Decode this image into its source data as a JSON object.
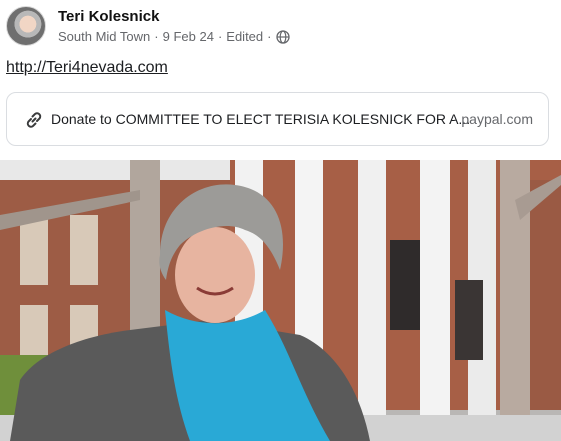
{
  "post": {
    "author_name": "Teri Kolesnick",
    "location": "South Mid Town",
    "date": "9 Feb 24",
    "edited": "Edited",
    "link_text": "http://Teri4nevada.com"
  },
  "link_preview": {
    "title": "Donate to COMMITTEE TO ELECT TERISIA KOLESNICK FOR A...",
    "domain": "· paypal.com"
  },
  "icons": {
    "privacy": "globe-icon",
    "link": "link-icon"
  }
}
